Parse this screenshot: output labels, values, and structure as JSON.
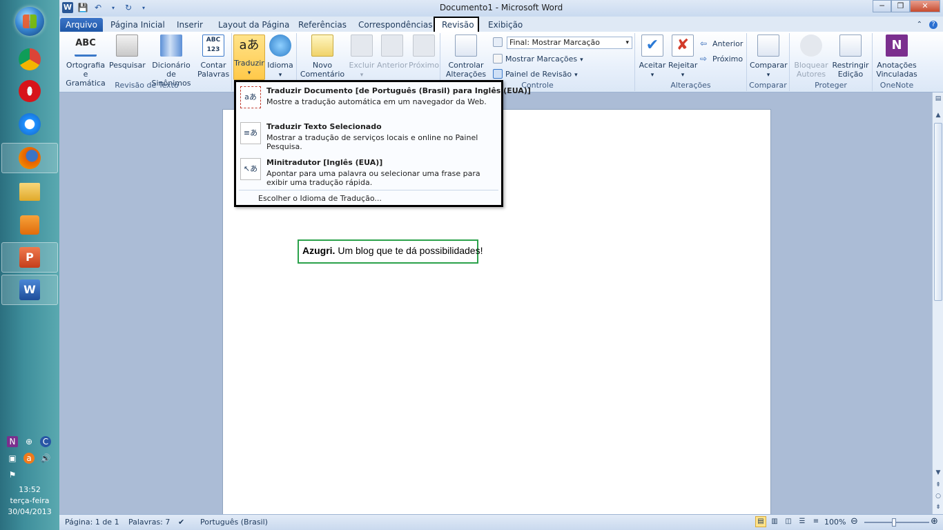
{
  "taskbar": {
    "apps": [
      {
        "name": "chrome-icon"
      },
      {
        "name": "opera-icon"
      },
      {
        "name": "internet-explorer-icon"
      },
      {
        "name": "firefox-icon"
      },
      {
        "name": "file-explorer-icon"
      },
      {
        "name": "media-player-icon"
      },
      {
        "name": "powerpoint-icon"
      },
      {
        "name": "word-icon"
      }
    ],
    "clock_time": "13:52",
    "clock_day": "terça-feira",
    "clock_date": "30/04/2013"
  },
  "window": {
    "title": "Documento1  -  Microsoft Word"
  },
  "tabs": {
    "file": "Arquivo",
    "home": "Página Inicial",
    "insert": "Inserir",
    "layout": "Layout da Página",
    "references": "Referências",
    "mailings": "Correspondências",
    "review": "Revisão",
    "view": "Exibição"
  },
  "ribbon": {
    "proofing": {
      "label": "Revisão de Texto",
      "spelling_l1": "Ortografia",
      "spelling_l2": "e Gramática",
      "research": "Pesquisar",
      "thesaurus_l1": "Dicionário de",
      "thesaurus_l2": "Sinônimos",
      "wordcount_l1": "Contar",
      "wordcount_l2": "Palavras"
    },
    "language": {
      "translate": "Traduzir",
      "language": "Idioma"
    },
    "comments": {
      "new_l1": "Novo",
      "new_l2": "Comentário",
      "delete": "Excluir",
      "previous": "Anterior",
      "next": "Próximo"
    },
    "tracking": {
      "label": "Controle",
      "track_l1": "Controlar",
      "track_l2": "Alterações",
      "display_select": "Final: Mostrar Marcação",
      "show_markup": "Mostrar Marcações",
      "review_pane": "Painel de Revisão"
    },
    "changes": {
      "label": "Alterações",
      "accept": "Aceitar",
      "reject": "Rejeitar",
      "previous": "Anterior",
      "next": "Próximo"
    },
    "compare": {
      "label": "Comparar",
      "compare": "Comparar"
    },
    "protect": {
      "label": "Proteger",
      "block_l1": "Bloquear",
      "block_l2": "Autores",
      "restrict_l1": "Restringir",
      "restrict_l2": "Edição"
    },
    "onenote": {
      "label": "OneNote",
      "linked_l1": "Anotações",
      "linked_l2": "Vinculadas"
    }
  },
  "translate_menu": {
    "items": [
      {
        "title": "Traduzir Documento [de Português (Brasil) para Inglês (EUA)]",
        "desc": "Mostre a tradução automática em um navegador da Web."
      },
      {
        "title": "Traduzir Texto Selecionado",
        "desc": "Mostrar a tradução de serviços locais e online no Painel Pesquisa."
      },
      {
        "title": "Minitradutor [Inglês (EUA)]",
        "desc": "Apontar para uma palavra ou selecionar uma frase para exibir uma tradução rápida."
      }
    ],
    "footer": "Escolher o Idioma de Tradução..."
  },
  "document": {
    "bold": "Azugri.",
    "rest": " Um blog que te dá possibilidades!"
  },
  "statusbar": {
    "page": "Página: 1 de 1",
    "words": "Palavras: 7",
    "language": "Português (Brasil)",
    "zoom": "100%"
  },
  "colors": {
    "file_tab": "#2b64b5",
    "highlight_box": "#2aa14a",
    "pressed_button": "#ffc94a"
  }
}
